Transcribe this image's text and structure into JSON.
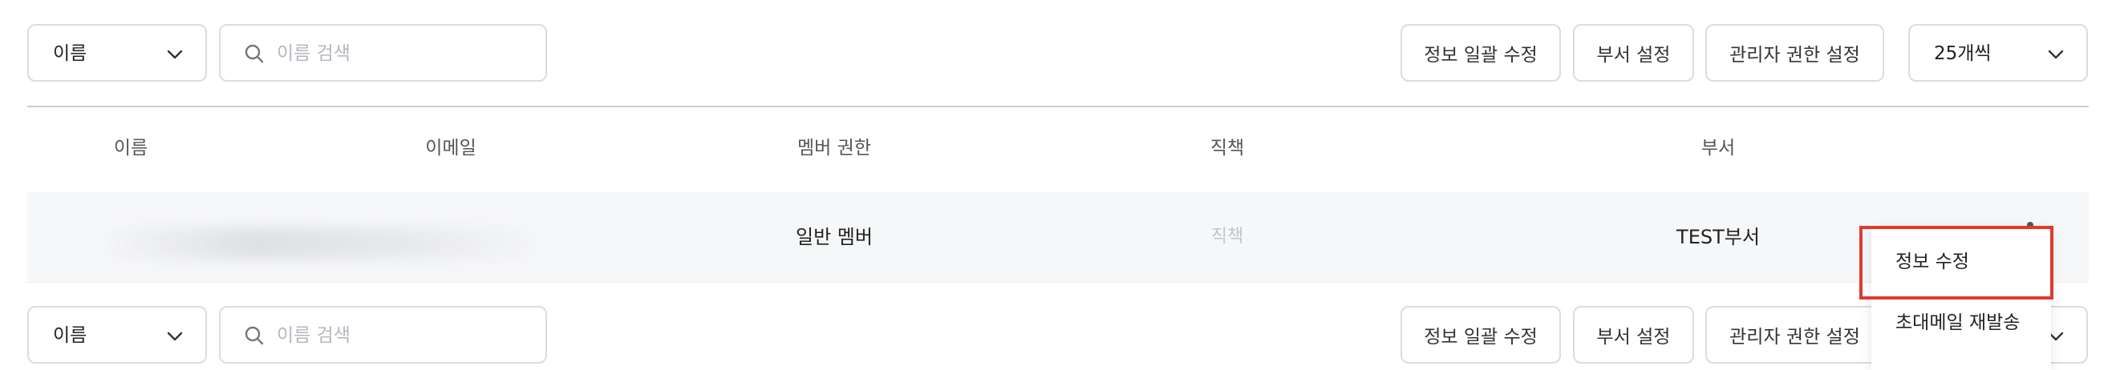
{
  "toolbar": {
    "field_select": "이름",
    "search_placeholder": "이름 검색",
    "bulk_edit_label": "정보 일괄 수정",
    "dept_setting_label": "부서 설정",
    "admin_perm_label": "관리자 권한 설정",
    "page_size": "25개씩"
  },
  "table": {
    "columns": [
      "이름",
      "이메일",
      "멤버 권한",
      "직책",
      "부서"
    ],
    "rows": [
      {
        "role": "일반 멤버",
        "position": "직책",
        "department": "TEST부서"
      }
    ]
  },
  "row_menu": {
    "items": [
      "정보 수정",
      "초대메일 재발송"
    ],
    "highlight_color": "#e03a2f"
  },
  "colors": {
    "border": "#d9dce1",
    "row_background": "#f6f7f9",
    "placeholder": "#b3b7be"
  }
}
